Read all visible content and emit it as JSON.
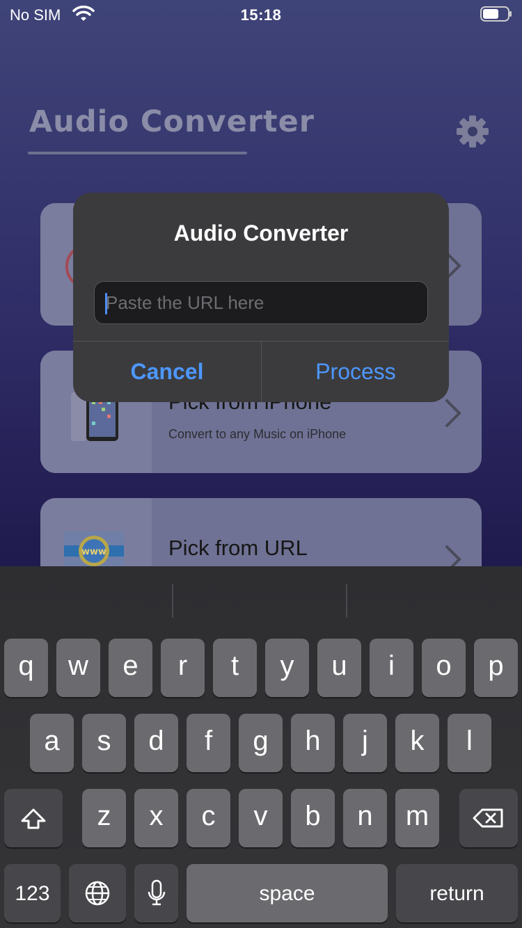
{
  "status_bar": {
    "carrier": "No SIM",
    "time": "15:18"
  },
  "header": {
    "title": "Audio Converter"
  },
  "cards": [
    {
      "title": "",
      "subtitle": ""
    },
    {
      "title": "Pick from iPhone",
      "subtitle": "Convert to any Music on iPhone"
    },
    {
      "title": "Pick from URL",
      "subtitle": ""
    }
  ],
  "alert": {
    "title": "Audio Converter",
    "input_placeholder": "Paste the URL here",
    "input_value": "",
    "cancel_label": "Cancel",
    "process_label": "Process"
  },
  "keyboard": {
    "row1": [
      "q",
      "w",
      "e",
      "r",
      "t",
      "y",
      "u",
      "i",
      "o",
      "p"
    ],
    "row2": [
      "a",
      "s",
      "d",
      "f",
      "g",
      "h",
      "j",
      "k",
      "l"
    ],
    "row3": [
      "z",
      "x",
      "c",
      "v",
      "b",
      "n",
      "m"
    ],
    "numbers_label": "123",
    "space_label": "space",
    "return_label": "return"
  },
  "colors": {
    "accent": "#4d97ff",
    "alert_bg": "#3b3b3e",
    "key_bg": "#6b6b6f",
    "key_dark_bg": "#47474b"
  }
}
